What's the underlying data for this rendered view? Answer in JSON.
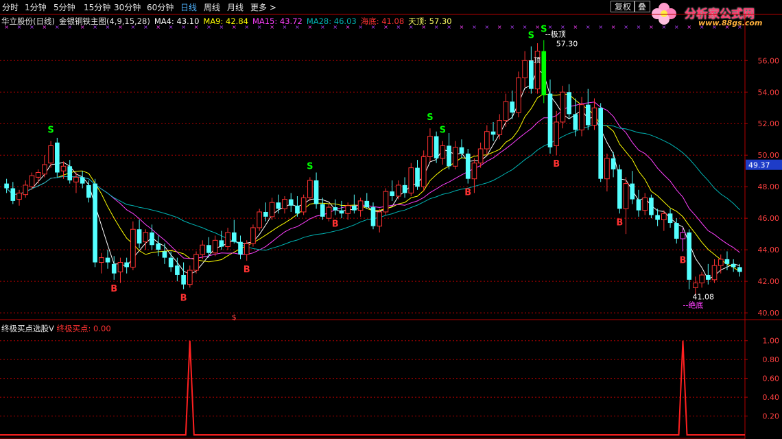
{
  "toolbar": {
    "periods": [
      "分时",
      "1分钟",
      "5分钟",
      "15分钟",
      "30分钟",
      "60分钟",
      "日线",
      "周线",
      "月线",
      "更多 >"
    ],
    "active_period": "日线",
    "restore_right_label": "复权",
    "second_button_label": "叠"
  },
  "logo": {
    "brand": "分析家公式网",
    "site": "www.88gs.com"
  },
  "legend": {
    "title": "华立股份(日线)",
    "indicator": "金银铜铁主图(4,9,15,28)",
    "ma4": "MA4: 43.10",
    "ma9": "MA9: 42.84",
    "ma15": "MA15: 43.72",
    "ma28": "MA28: 46.03",
    "bottom_label": "海底: 41.08",
    "top_label": "天顶: 57.30"
  },
  "indicator_legend": {
    "name": "终极买点选股V",
    "value": "终极买点: 0.00"
  },
  "colors": {
    "up": "#ff3232",
    "down": "#54ffff",
    "ma4": "#ffffff",
    "ma9": "#ffff00",
    "ma15": "#ff40ff",
    "ma28": "#00b4b4",
    "buy": "#ff3232",
    "sell": "#00ff00",
    "axis": "#b40000",
    "grid": "#b40000"
  },
  "chart_data": [
    {
      "type": "candlestick",
      "title": "华立股份(日线)",
      "ylim": [
        39.7,
        58.1
      ],
      "y_ticks": [
        "40.00",
        "42.00",
        "44.00",
        "46.00",
        "48.00",
        "50.00",
        "52.00",
        "54.00",
        "56.00"
      ],
      "y_tick_values": [
        40,
        42,
        44,
        46,
        48,
        50,
        52,
        54,
        56
      ],
      "current_price": "49.37",
      "current_price_value": 49.37,
      "candles": [
        [
          48.2,
          48.5,
          47.6,
          47.9
        ],
        [
          47.9,
          48.3,
          46.9,
          47.1
        ],
        [
          47.2,
          47.8,
          46.8,
          47.6
        ],
        [
          47.5,
          48.4,
          47.3,
          48.1
        ],
        [
          48.0,
          48.9,
          47.8,
          48.7
        ],
        [
          48.6,
          49.1,
          48.2,
          48.9
        ],
        [
          48.8,
          50.0,
          48.6,
          49.4
        ],
        [
          49.5,
          50.9,
          49.2,
          50.6
        ],
        [
          50.8,
          51.1,
          48.6,
          48.9
        ],
        [
          49.0,
          49.6,
          48.5,
          49.3
        ],
        [
          49.3,
          49.7,
          48.2,
          48.4
        ],
        [
          48.3,
          48.9,
          47.6,
          48.6
        ],
        [
          48.6,
          49.0,
          47.9,
          48.2
        ],
        [
          48.1,
          48.4,
          47.0,
          47.3
        ],
        [
          48.2,
          48.5,
          42.9,
          43.2
        ],
        [
          43.2,
          43.8,
          42.5,
          43.5
        ],
        [
          43.5,
          44.0,
          42.8,
          43.2
        ],
        [
          43.1,
          43.6,
          42.1,
          42.5
        ],
        [
          42.6,
          43.5,
          41.9,
          43.2
        ],
        [
          43.2,
          43.5,
          42.5,
          42.9
        ],
        [
          42.9,
          45.8,
          42.7,
          45.3
        ],
        [
          45.3,
          45.9,
          44.1,
          44.4
        ],
        [
          44.5,
          45.3,
          44.0,
          45.1
        ],
        [
          45.1,
          45.6,
          44.0,
          44.3
        ],
        [
          44.4,
          44.9,
          43.6,
          44.0
        ],
        [
          43.9,
          44.4,
          43.1,
          43.5
        ],
        [
          43.5,
          43.9,
          42.6,
          42.9
        ],
        [
          43.0,
          43.5,
          42.0,
          42.4
        ],
        [
          42.4,
          43.2,
          41.5,
          41.8
        ],
        [
          41.8,
          43.0,
          41.6,
          42.7
        ],
        [
          42.7,
          43.9,
          42.5,
          43.7
        ],
        [
          43.7,
          44.6,
          43.4,
          44.3
        ],
        [
          44.3,
          44.8,
          43.5,
          43.8
        ],
        [
          43.8,
          44.9,
          43.6,
          44.6
        ],
        [
          44.6,
          45.2,
          44.0,
          44.2
        ],
        [
          44.2,
          45.4,
          44.0,
          45.1
        ],
        [
          45.1,
          45.9,
          44.4,
          44.5
        ],
        [
          44.5,
          44.9,
          43.4,
          43.7
        ],
        [
          43.7,
          44.6,
          43.3,
          44.4
        ],
        [
          44.4,
          45.6,
          44.2,
          45.4
        ],
        [
          45.4,
          46.6,
          45.2,
          46.4
        ],
        [
          46.4,
          47.0,
          45.8,
          46.1
        ],
        [
          46.1,
          47.3,
          45.9,
          47.0
        ],
        [
          47.0,
          47.5,
          46.3,
          46.6
        ],
        [
          46.6,
          47.4,
          46.3,
          47.2
        ],
        [
          47.2,
          47.6,
          46.4,
          46.8
        ],
        [
          46.8,
          47.4,
          46.1,
          46.3
        ],
        [
          46.4,
          47.5,
          46.2,
          47.3
        ],
        [
          47.3,
          48.6,
          47.1,
          48.4
        ],
        [
          48.4,
          48.9,
          46.6,
          46.9
        ],
        [
          46.9,
          47.3,
          45.9,
          46.1
        ],
        [
          46.0,
          46.9,
          45.8,
          46.7
        ],
        [
          46.7,
          47.2,
          46.2,
          46.5
        ],
        [
          46.5,
          47.1,
          46.0,
          46.3
        ],
        [
          46.3,
          47.0,
          45.9,
          46.8
        ],
        [
          46.8,
          47.5,
          46.3,
          46.5
        ],
        [
          46.5,
          47.3,
          46.1,
          47.1
        ],
        [
          47.1,
          47.6,
          46.6,
          46.7
        ],
        [
          46.7,
          47.0,
          45.3,
          45.5
        ],
        [
          45.5,
          46.6,
          45.1,
          46.4
        ],
        [
          46.4,
          47.9,
          46.2,
          47.7
        ],
        [
          47.7,
          48.4,
          47.1,
          47.4
        ],
        [
          47.4,
          48.4,
          47.2,
          48.1
        ],
        [
          48.1,
          48.6,
          47.3,
          47.6
        ],
        [
          47.6,
          49.5,
          47.4,
          49.2
        ],
        [
          49.2,
          49.7,
          47.8,
          48.0
        ],
        [
          48.0,
          50.3,
          47.7,
          49.9
        ],
        [
          49.9,
          51.7,
          49.6,
          51.2
        ],
        [
          51.2,
          51.5,
          49.5,
          49.8
        ],
        [
          49.8,
          50.9,
          49.4,
          50.6
        ],
        [
          50.6,
          51.4,
          49.1,
          49.3
        ],
        [
          49.3,
          50.9,
          49.1,
          50.5
        ],
        [
          50.5,
          51.0,
          49.8,
          50.1
        ],
        [
          50.1,
          50.4,
          48.2,
          48.5
        ],
        [
          48.5,
          49.8,
          47.6,
          49.5
        ],
        [
          49.5,
          50.8,
          49.2,
          50.4
        ],
        [
          50.4,
          51.9,
          50.0,
          51.5
        ],
        [
          51.5,
          52.1,
          50.9,
          51.3
        ],
        [
          51.3,
          52.6,
          51.0,
          52.2
        ],
        [
          52.2,
          53.9,
          51.8,
          53.4
        ],
        [
          53.4,
          54.1,
          52.3,
          52.7
        ],
        [
          52.7,
          55.3,
          52.4,
          54.9
        ],
        [
          54.9,
          56.6,
          54.3,
          56.0
        ],
        [
          56.0,
          56.9,
          53.9,
          54.2
        ],
        [
          54.2,
          57.1,
          53.9,
          56.6
        ],
        [
          56.6,
          57.3,
          53.3,
          53.8
        ],
        [
          53.9,
          54.8,
          50.1,
          50.5
        ],
        [
          50.6,
          52.8,
          50.0,
          52.1
        ],
        [
          52.1,
          54.4,
          51.7,
          54.0
        ],
        [
          54.0,
          54.5,
          52.3,
          52.6
        ],
        [
          52.6,
          53.6,
          51.2,
          51.6
        ],
        [
          51.6,
          53.7,
          51.2,
          53.2
        ],
        [
          53.2,
          54.2,
          51.6,
          51.9
        ],
        [
          51.9,
          53.6,
          51.6,
          53.0
        ],
        [
          53.0,
          53.3,
          48.3,
          48.5
        ],
        [
          48.5,
          50.1,
          47.7,
          49.8
        ],
        [
          49.8,
          50.2,
          48.6,
          49.1
        ],
        [
          49.1,
          49.4,
          46.3,
          46.6
        ],
        [
          46.6,
          48.6,
          45.0,
          48.2
        ],
        [
          48.2,
          49.0,
          46.9,
          47.2
        ],
        [
          47.2,
          47.8,
          46.1,
          46.5
        ],
        [
          46.5,
          47.6,
          46.2,
          47.3
        ],
        [
          47.3,
          47.5,
          46.0,
          46.2
        ],
        [
          46.2,
          46.6,
          45.5,
          45.9
        ],
        [
          45.9,
          46.5,
          45.2,
          46.3
        ],
        [
          46.3,
          46.6,
          45.4,
          45.7
        ],
        [
          45.7,
          46.0,
          44.4,
          44.7
        ],
        [
          44.7,
          45.4,
          43.9,
          45.1
        ],
        [
          45.1,
          45.3,
          41.5,
          42.1
        ],
        [
          41.6,
          42.3,
          41.08,
          41.9
        ],
        [
          41.9,
          42.6,
          41.6,
          42.4
        ],
        [
          42.4,
          43.1,
          41.8,
          42.1
        ],
        [
          42.1,
          43.4,
          41.9,
          43.0
        ],
        [
          43.0,
          43.7,
          42.5,
          43.4
        ],
        [
          43.4,
          43.9,
          42.7,
          43.1
        ],
        [
          43.1,
          43.4,
          42.6,
          42.9
        ],
        [
          42.9,
          43.1,
          42.3,
          42.6
        ]
      ],
      "signals": [
        {
          "index": 7,
          "type": "S"
        },
        {
          "index": 17,
          "type": "B"
        },
        {
          "index": 28,
          "type": "B"
        },
        {
          "index": 38,
          "type": "B"
        },
        {
          "index": 48,
          "type": "S"
        },
        {
          "index": 52,
          "type": "B"
        },
        {
          "index": 67,
          "type": "S"
        },
        {
          "index": 69,
          "type": "S"
        },
        {
          "index": 73,
          "type": "B"
        },
        {
          "index": 83,
          "type": "S"
        },
        {
          "index": 85,
          "type": "S"
        },
        {
          "index": 87,
          "type": "B"
        },
        {
          "index": 97,
          "type": "B"
        },
        {
          "index": 107,
          "type": "B"
        }
      ],
      "annotations": {
        "top_text": "--极顶",
        "top_value": "57.30",
        "top_mark": "--顶",
        "top_index": 85,
        "bottom_text": "--绝底",
        "bottom_value": "41.08",
        "bottom_index": 107,
        "dollar_mark": "$",
        "dollar_index": 36
      }
    },
    {
      "type": "line",
      "title": "终极买点选股V",
      "series": [
        {
          "name": "终极买点",
          "spikes_at_index": [
            29,
            107
          ]
        }
      ],
      "ylim": [
        0,
        1.1
      ],
      "y_ticks": [
        "0.20",
        "0.40",
        "0.60",
        "0.80",
        "1.00"
      ],
      "y_tick_values": [
        0.2,
        0.4,
        0.6,
        0.8,
        1.0
      ]
    }
  ]
}
